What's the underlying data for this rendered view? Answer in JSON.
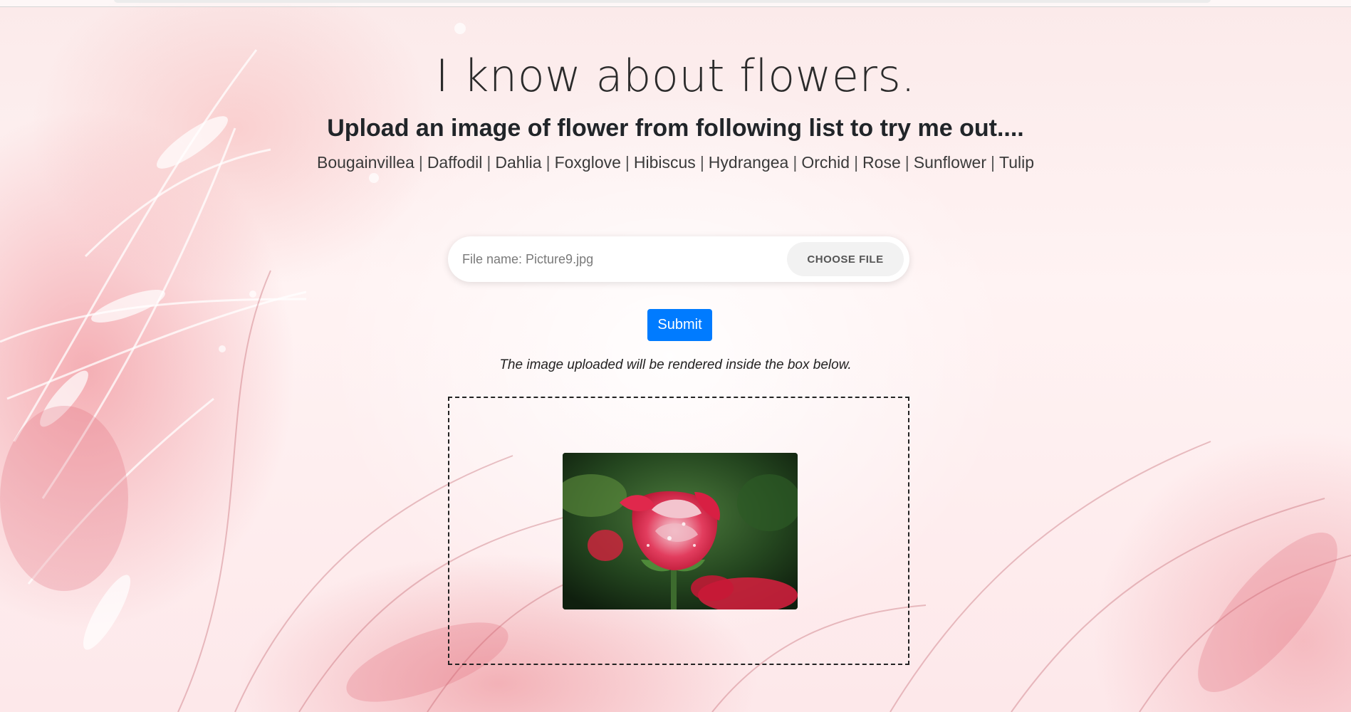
{
  "page": {
    "title": "I know about flowers.",
    "subtitle": "Upload an image of flower from following list to try me out....",
    "flowers": [
      "Bougainvillea",
      "Daffodil",
      "Dahlia",
      "Foxglove",
      "Hibiscus",
      "Hydrangea",
      "Orchid",
      "Rose",
      "Sunflower",
      "Tulip"
    ],
    "separator": "|"
  },
  "upload": {
    "file_name_text": "File name: Picture9.jpg",
    "choose_file_label": "CHOOSE FILE",
    "submit_label": "Submit"
  },
  "preview": {
    "hint": "The image uploaded will be rendered inside the box below.",
    "image_subject": "red-white rose with water droplets"
  },
  "colors": {
    "primary_button": "#007bff",
    "background_accent": "#f2a7ad"
  }
}
